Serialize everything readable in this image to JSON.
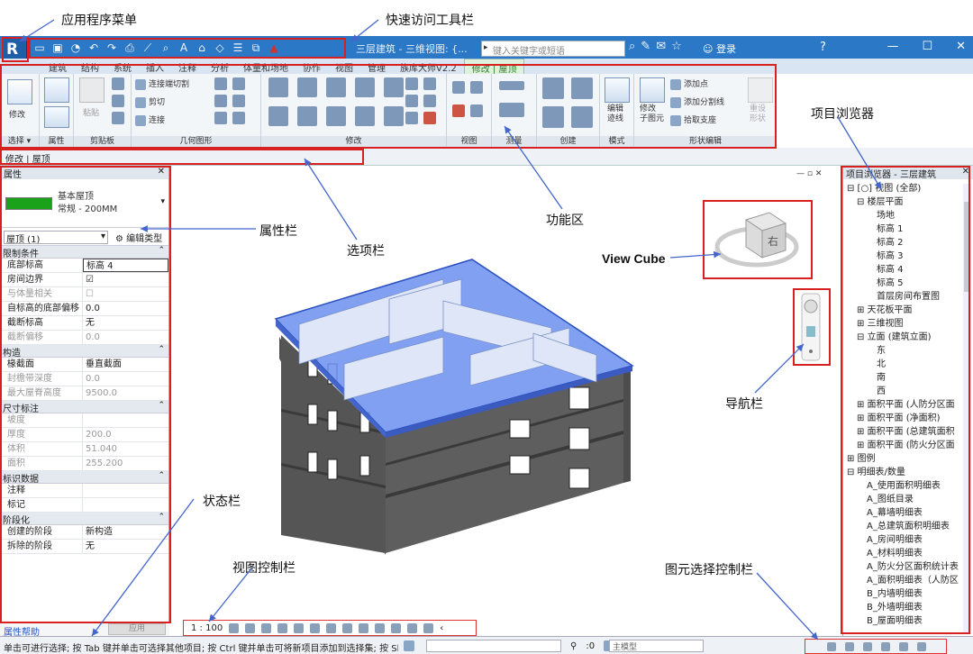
{
  "annotations": {
    "app_menu": "应用程序菜单",
    "qat": "快速访问工具栏",
    "ribbon": "功能区",
    "properties": "属性栏",
    "options_bar": "选项栏",
    "view_cube": "View Cube",
    "navigation": "导航栏",
    "project_browser": "项目浏览器",
    "status_bar": "状态栏",
    "view_control": "视图控制栏",
    "selection_control": "图元选择控制栏"
  },
  "titlebar": {
    "doc_title": "三层建筑 - 三维视图: {...",
    "search_placeholder": "键入关键字或短语",
    "login": "登录",
    "help": "?"
  },
  "tabs": [
    "建筑",
    "结构",
    "系统",
    "插入",
    "注释",
    "分析",
    "体量和场地",
    "协作",
    "视图",
    "管理",
    "族库大师V2.2",
    "修改 | 屋顶"
  ],
  "ribbon": {
    "modify_label": "修改",
    "panels": {
      "select": "选择 ▾",
      "properties": "属性",
      "clipboard": "剪贴板",
      "geometry": "几何图形",
      "modify": "修改",
      "view": "视图",
      "measure": "测量",
      "create": "创建",
      "mode": "模式",
      "shape_edit": "形状编辑"
    },
    "paste": "粘贴",
    "connect_cut": "连接端切割",
    "cut": "剪切",
    "join": "连接",
    "edit_footprint": "编辑\n迹线",
    "modify_sub": "修改\n子图元",
    "add_point": "添加点",
    "add_split_line": "添加分割线",
    "pick_support": "拾取支座",
    "reset_shape": "重设\n形状"
  },
  "options_bar": {
    "text": "修改 | 屋顶"
  },
  "properties": {
    "header": "属性",
    "type_name": "基本屋顶",
    "type_sub": "常规 - 200MM",
    "instance": "屋顶 (1)",
    "edit_type": "编辑类型",
    "groups": [
      {
        "name": "限制条件",
        "rows": [
          {
            "k": "底部标高",
            "v": "标高 4",
            "dim": false,
            "hl": true
          },
          {
            "k": "房间边界",
            "v": "☑",
            "dim": false
          },
          {
            "k": "与体量相关",
            "v": "☐",
            "dim": true
          },
          {
            "k": "自标高的底部偏移",
            "v": "0.0",
            "dim": false
          },
          {
            "k": "截断标高",
            "v": "无",
            "dim": false
          },
          {
            "k": "截断偏移",
            "v": "0.0",
            "dim": true
          }
        ]
      },
      {
        "name": "构造",
        "rows": [
          {
            "k": "椽截面",
            "v": "垂直截面",
            "dim": false
          },
          {
            "k": "封檐带深度",
            "v": "0.0",
            "dim": true
          },
          {
            "k": "最大屋脊高度",
            "v": "9500.0",
            "dim": true
          }
        ]
      },
      {
        "name": "尺寸标注",
        "rows": [
          {
            "k": "坡度",
            "v": "",
            "dim": true
          },
          {
            "k": "厚度",
            "v": "200.0",
            "dim": true
          },
          {
            "k": "体积",
            "v": "51.040",
            "dim": true
          },
          {
            "k": "面积",
            "v": "255.200",
            "dim": true
          }
        ]
      },
      {
        "name": "标识数据",
        "rows": [
          {
            "k": "注释",
            "v": "",
            "dim": false
          },
          {
            "k": "标记",
            "v": "",
            "dim": false
          }
        ]
      },
      {
        "name": "阶段化",
        "rows": [
          {
            "k": "创建的阶段",
            "v": "新构造",
            "dim": false
          },
          {
            "k": "拆除的阶段",
            "v": "无",
            "dim": false
          }
        ]
      }
    ],
    "help": "属性帮助",
    "apply": "应用"
  },
  "browser": {
    "header": "项目浏览器 - 三层建筑",
    "tree": [
      {
        "t": "⊟ [○] 视图 (全部)",
        "l": 0
      },
      {
        "t": "⊟ 楼层平面",
        "l": 1
      },
      {
        "t": "场地",
        "l": 3
      },
      {
        "t": "标高 1",
        "l": 3
      },
      {
        "t": "标高 2",
        "l": 3
      },
      {
        "t": "标高 3",
        "l": 3
      },
      {
        "t": "标高 4",
        "l": 3
      },
      {
        "t": "标高 5",
        "l": 3
      },
      {
        "t": "首层房间布置图",
        "l": 3
      },
      {
        "t": "⊞ 天花板平面",
        "l": 1
      },
      {
        "t": "⊞ 三维视图",
        "l": 1
      },
      {
        "t": "⊟ 立面 (建筑立面)",
        "l": 1
      },
      {
        "t": "东",
        "l": 3
      },
      {
        "t": "北",
        "l": 3
      },
      {
        "t": "南",
        "l": 3
      },
      {
        "t": "西",
        "l": 3
      },
      {
        "t": "⊞ 面积平面 (人防分区面",
        "l": 1
      },
      {
        "t": "⊞ 面积平面 (净面积)",
        "l": 1
      },
      {
        "t": "⊞ 面积平面 (总建筑面积",
        "l": 1
      },
      {
        "t": "⊞ 面积平面 (防火分区面",
        "l": 1
      },
      {
        "t": "⊞ 图例",
        "l": 0
      },
      {
        "t": "⊟ 明细表/数量",
        "l": 0
      },
      {
        "t": "A_使用面积明细表",
        "l": 2
      },
      {
        "t": "A_图纸目录",
        "l": 2
      },
      {
        "t": "A_幕墙明细表",
        "l": 2
      },
      {
        "t": "A_总建筑面积明细表",
        "l": 2
      },
      {
        "t": "A_房间明细表",
        "l": 2
      },
      {
        "t": "A_材料明细表",
        "l": 2
      },
      {
        "t": "A_防火分区面积统计表",
        "l": 2
      },
      {
        "t": "A_面积明细表（人防区",
        "l": 2
      },
      {
        "t": "B_内墙明细表",
        "l": 2
      },
      {
        "t": "B_外墙明细表",
        "l": 2
      },
      {
        "t": "B_屋面明细表",
        "l": 2
      }
    ]
  },
  "view_control": {
    "scale": "1 : 100"
  },
  "status": {
    "text": "单击可进行选择; 按 Tab 键并单击可选择其他项目; 按 Ctrl 键并单击可将新项目添加到选择集; 按 Shift 键",
    "zero": ":0",
    "model": "主模型"
  },
  "view_cube": {
    "face": "右"
  },
  "colors": {
    "title": "#2b78c6",
    "roof": "#5a7de8",
    "annotation": "#d82020",
    "type_swatch": "#1ba21b"
  }
}
